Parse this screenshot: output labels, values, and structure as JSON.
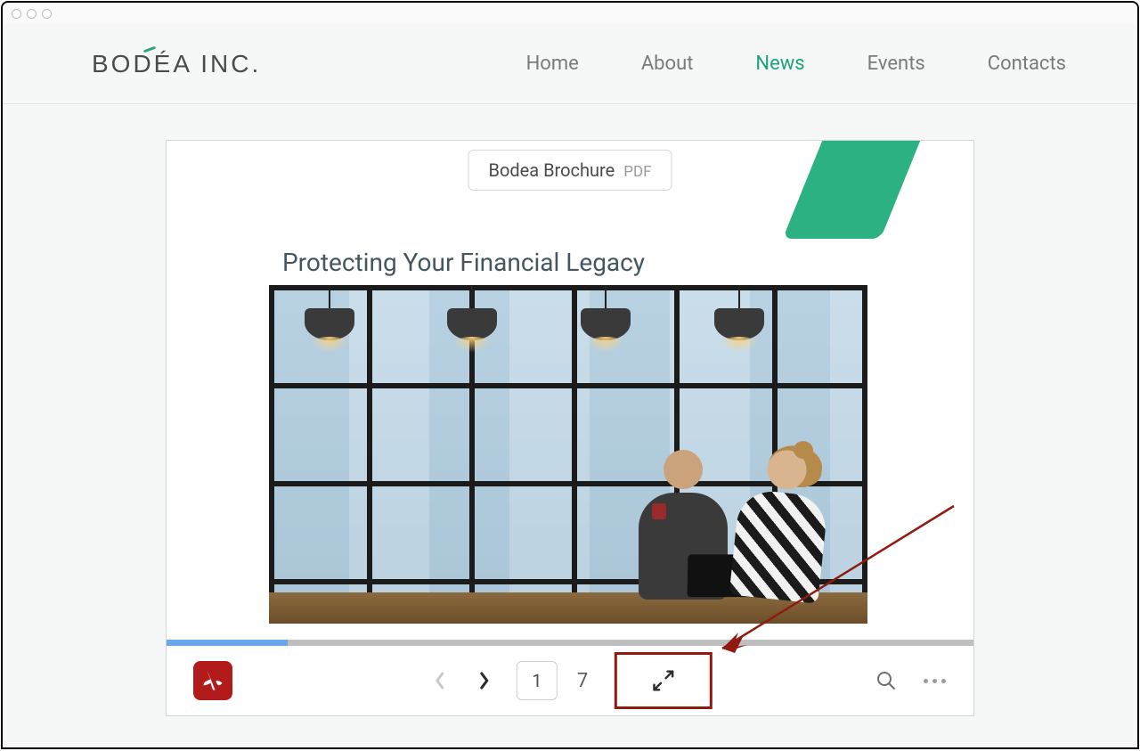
{
  "brand": {
    "name": "BODÉA INC."
  },
  "nav": {
    "items": [
      {
        "label": "Home",
        "active": false
      },
      {
        "label": "About",
        "active": false
      },
      {
        "label": "News",
        "active": true
      },
      {
        "label": "Events",
        "active": false
      },
      {
        "label": "Contacts",
        "active": false
      }
    ]
  },
  "document": {
    "badge_title": "Bodea Brochure",
    "badge_ext": "PDF",
    "page_heading": "Protecting Your Financial Legacy"
  },
  "viewer": {
    "progress_percent": 15,
    "current_page": "1",
    "total_pages": "7"
  },
  "colors": {
    "accent": "#1da37a",
    "annotation": "#8f1a0f",
    "acrobat_red": "#b31b1b"
  }
}
